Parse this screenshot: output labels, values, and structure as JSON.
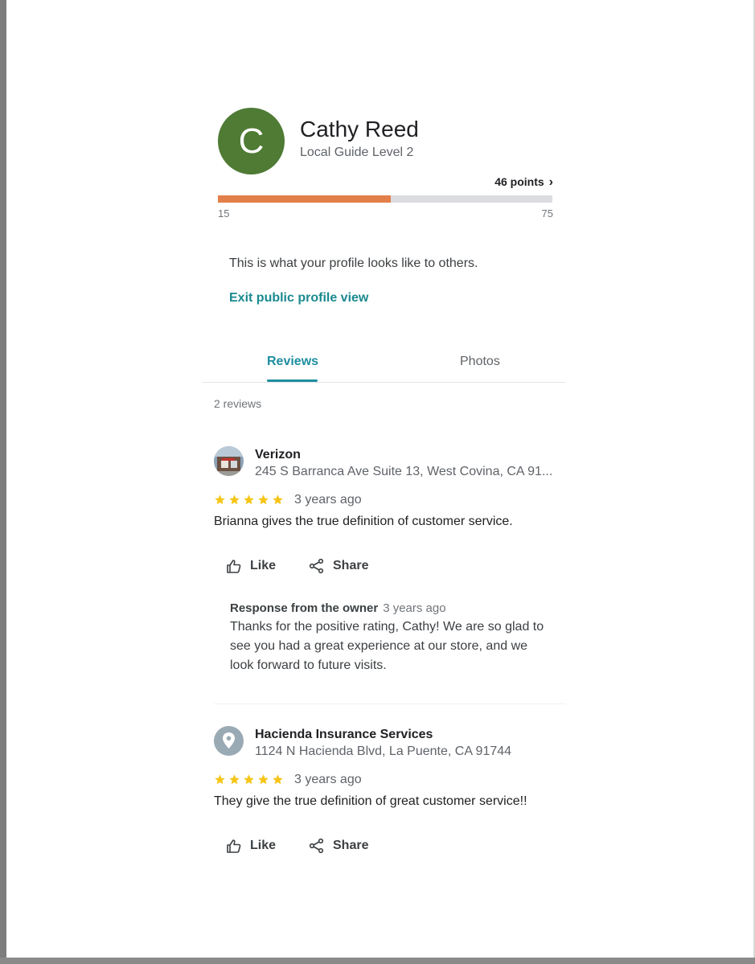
{
  "profile": {
    "avatar_letter": "C",
    "avatar_color": "#4f7b35",
    "name": "Cathy Reed",
    "level": "Local Guide Level 2",
    "points_label": "46 points",
    "points_value": 46,
    "progress": {
      "min_label": "15",
      "max_label": "75",
      "min": 15,
      "max": 75,
      "value": 46,
      "fill_color": "#e37f4a"
    }
  },
  "notice": {
    "text": "This is what your profile looks like to others.",
    "exit_link": "Exit public profile view"
  },
  "tabs": [
    {
      "label": "Reviews",
      "active": true
    },
    {
      "label": "Photos",
      "active": false
    }
  ],
  "accent_color": "#1e8ea0",
  "star_color": "#f5c518",
  "review_count": "2 reviews",
  "reviews": [
    {
      "place": "Verizon",
      "address": "245 S Barranca Ave Suite 13, West Covina, CA 91...",
      "icon": "place-photo",
      "rating": 5,
      "date": "3 years ago",
      "text": "Brianna gives the true definition of customer service.",
      "like_label": "Like",
      "share_label": "Share",
      "owner_response": {
        "title": "Response from the owner",
        "date": "3 years ago",
        "text": "Thanks for the positive rating, Cathy! We are so glad to see you had a great experience at our store, and we look forward to future visits."
      }
    },
    {
      "place": "Hacienda Insurance Services",
      "address": "1124 N Hacienda Blvd, La Puente, CA 91744",
      "icon": "location-pin-icon",
      "rating": 5,
      "date": "3 years ago",
      "text": "They give the true definition of great customer service!!",
      "like_label": "Like",
      "share_label": "Share"
    }
  ]
}
